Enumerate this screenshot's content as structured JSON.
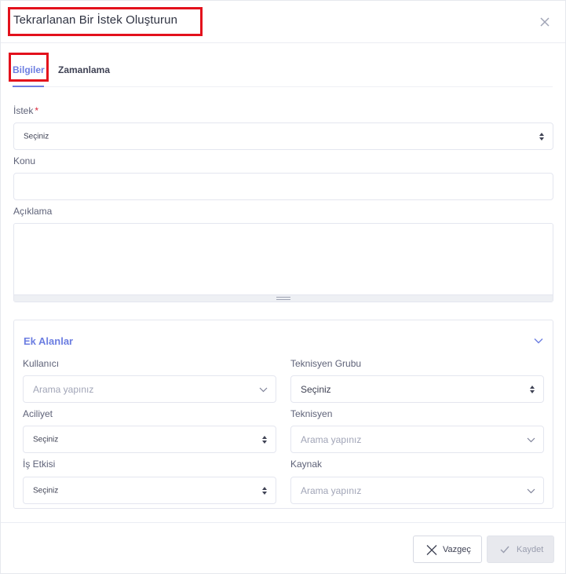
{
  "dialog": {
    "title": "Tekrarlanan Bir İstek Oluşturun"
  },
  "tabs": [
    {
      "label": "Bilgiler",
      "active": true
    },
    {
      "label": "Zamanlama",
      "active": false
    }
  ],
  "form": {
    "istek": {
      "label": "İstek",
      "required_mark": "*",
      "value": "Seçiniz"
    },
    "konu": {
      "label": "Konu",
      "value": ""
    },
    "aciklama": {
      "label": "Açıklama",
      "value": ""
    }
  },
  "ek_alanlar": {
    "title": "Ek Alanlar",
    "kullanici": {
      "label": "Kullanıcı",
      "placeholder": "Arama yapınız"
    },
    "teknisyen_grubu": {
      "label": "Teknisyen Grubu",
      "value": "Seçiniz"
    },
    "aciliyet": {
      "label": "Aciliyet",
      "value": "Seçiniz"
    },
    "teknisyen": {
      "label": "Teknisyen",
      "placeholder": "Arama yapınız"
    },
    "is_etkisi": {
      "label": "İş Etkisi",
      "value": "Seçiniz"
    },
    "kaynak": {
      "label": "Kaynak",
      "placeholder": "Arama yapınız"
    }
  },
  "footer": {
    "cancel_label": "Vazgeç",
    "save_label": "Kaydet"
  },
  "colors": {
    "accent": "#6c7ee1",
    "highlight_box": "#e3111c",
    "border": "#e4e6ef"
  }
}
